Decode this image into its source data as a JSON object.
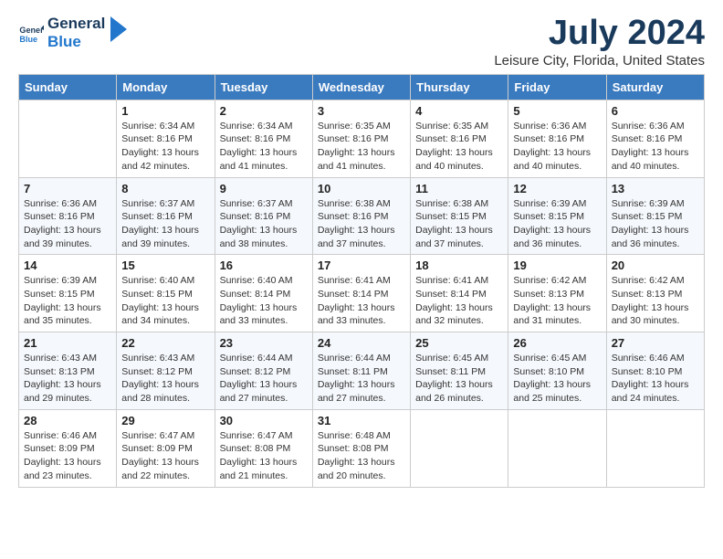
{
  "logo": {
    "general": "General",
    "blue": "Blue"
  },
  "header": {
    "month_year": "July 2024",
    "location": "Leisure City, Florida, United States"
  },
  "days_of_week": [
    "Sunday",
    "Monday",
    "Tuesday",
    "Wednesday",
    "Thursday",
    "Friday",
    "Saturday"
  ],
  "weeks": [
    [
      {
        "day": "",
        "sunrise": "",
        "sunset": "",
        "daylight": ""
      },
      {
        "day": "1",
        "sunrise": "Sunrise: 6:34 AM",
        "sunset": "Sunset: 8:16 PM",
        "daylight": "Daylight: 13 hours and 42 minutes."
      },
      {
        "day": "2",
        "sunrise": "Sunrise: 6:34 AM",
        "sunset": "Sunset: 8:16 PM",
        "daylight": "Daylight: 13 hours and 41 minutes."
      },
      {
        "day": "3",
        "sunrise": "Sunrise: 6:35 AM",
        "sunset": "Sunset: 8:16 PM",
        "daylight": "Daylight: 13 hours and 41 minutes."
      },
      {
        "day": "4",
        "sunrise": "Sunrise: 6:35 AM",
        "sunset": "Sunset: 8:16 PM",
        "daylight": "Daylight: 13 hours and 40 minutes."
      },
      {
        "day": "5",
        "sunrise": "Sunrise: 6:36 AM",
        "sunset": "Sunset: 8:16 PM",
        "daylight": "Daylight: 13 hours and 40 minutes."
      },
      {
        "day": "6",
        "sunrise": "Sunrise: 6:36 AM",
        "sunset": "Sunset: 8:16 PM",
        "daylight": "Daylight: 13 hours and 40 minutes."
      }
    ],
    [
      {
        "day": "7",
        "sunrise": "Sunrise: 6:36 AM",
        "sunset": "Sunset: 8:16 PM",
        "daylight": "Daylight: 13 hours and 39 minutes."
      },
      {
        "day": "8",
        "sunrise": "Sunrise: 6:37 AM",
        "sunset": "Sunset: 8:16 PM",
        "daylight": "Daylight: 13 hours and 39 minutes."
      },
      {
        "day": "9",
        "sunrise": "Sunrise: 6:37 AM",
        "sunset": "Sunset: 8:16 PM",
        "daylight": "Daylight: 13 hours and 38 minutes."
      },
      {
        "day": "10",
        "sunrise": "Sunrise: 6:38 AM",
        "sunset": "Sunset: 8:16 PM",
        "daylight": "Daylight: 13 hours and 37 minutes."
      },
      {
        "day": "11",
        "sunrise": "Sunrise: 6:38 AM",
        "sunset": "Sunset: 8:15 PM",
        "daylight": "Daylight: 13 hours and 37 minutes."
      },
      {
        "day": "12",
        "sunrise": "Sunrise: 6:39 AM",
        "sunset": "Sunset: 8:15 PM",
        "daylight": "Daylight: 13 hours and 36 minutes."
      },
      {
        "day": "13",
        "sunrise": "Sunrise: 6:39 AM",
        "sunset": "Sunset: 8:15 PM",
        "daylight": "Daylight: 13 hours and 36 minutes."
      }
    ],
    [
      {
        "day": "14",
        "sunrise": "Sunrise: 6:39 AM",
        "sunset": "Sunset: 8:15 PM",
        "daylight": "Daylight: 13 hours and 35 minutes."
      },
      {
        "day": "15",
        "sunrise": "Sunrise: 6:40 AM",
        "sunset": "Sunset: 8:15 PM",
        "daylight": "Daylight: 13 hours and 34 minutes."
      },
      {
        "day": "16",
        "sunrise": "Sunrise: 6:40 AM",
        "sunset": "Sunset: 8:14 PM",
        "daylight": "Daylight: 13 hours and 33 minutes."
      },
      {
        "day": "17",
        "sunrise": "Sunrise: 6:41 AM",
        "sunset": "Sunset: 8:14 PM",
        "daylight": "Daylight: 13 hours and 33 minutes."
      },
      {
        "day": "18",
        "sunrise": "Sunrise: 6:41 AM",
        "sunset": "Sunset: 8:14 PM",
        "daylight": "Daylight: 13 hours and 32 minutes."
      },
      {
        "day": "19",
        "sunrise": "Sunrise: 6:42 AM",
        "sunset": "Sunset: 8:13 PM",
        "daylight": "Daylight: 13 hours and 31 minutes."
      },
      {
        "day": "20",
        "sunrise": "Sunrise: 6:42 AM",
        "sunset": "Sunset: 8:13 PM",
        "daylight": "Daylight: 13 hours and 30 minutes."
      }
    ],
    [
      {
        "day": "21",
        "sunrise": "Sunrise: 6:43 AM",
        "sunset": "Sunset: 8:13 PM",
        "daylight": "Daylight: 13 hours and 29 minutes."
      },
      {
        "day": "22",
        "sunrise": "Sunrise: 6:43 AM",
        "sunset": "Sunset: 8:12 PM",
        "daylight": "Daylight: 13 hours and 28 minutes."
      },
      {
        "day": "23",
        "sunrise": "Sunrise: 6:44 AM",
        "sunset": "Sunset: 8:12 PM",
        "daylight": "Daylight: 13 hours and 27 minutes."
      },
      {
        "day": "24",
        "sunrise": "Sunrise: 6:44 AM",
        "sunset": "Sunset: 8:11 PM",
        "daylight": "Daylight: 13 hours and 27 minutes."
      },
      {
        "day": "25",
        "sunrise": "Sunrise: 6:45 AM",
        "sunset": "Sunset: 8:11 PM",
        "daylight": "Daylight: 13 hours and 26 minutes."
      },
      {
        "day": "26",
        "sunrise": "Sunrise: 6:45 AM",
        "sunset": "Sunset: 8:10 PM",
        "daylight": "Daylight: 13 hours and 25 minutes."
      },
      {
        "day": "27",
        "sunrise": "Sunrise: 6:46 AM",
        "sunset": "Sunset: 8:10 PM",
        "daylight": "Daylight: 13 hours and 24 minutes."
      }
    ],
    [
      {
        "day": "28",
        "sunrise": "Sunrise: 6:46 AM",
        "sunset": "Sunset: 8:09 PM",
        "daylight": "Daylight: 13 hours and 23 minutes."
      },
      {
        "day": "29",
        "sunrise": "Sunrise: 6:47 AM",
        "sunset": "Sunset: 8:09 PM",
        "daylight": "Daylight: 13 hours and 22 minutes."
      },
      {
        "day": "30",
        "sunrise": "Sunrise: 6:47 AM",
        "sunset": "Sunset: 8:08 PM",
        "daylight": "Daylight: 13 hours and 21 minutes."
      },
      {
        "day": "31",
        "sunrise": "Sunrise: 6:48 AM",
        "sunset": "Sunset: 8:08 PM",
        "daylight": "Daylight: 13 hours and 20 minutes."
      },
      {
        "day": "",
        "sunrise": "",
        "sunset": "",
        "daylight": ""
      },
      {
        "day": "",
        "sunrise": "",
        "sunset": "",
        "daylight": ""
      },
      {
        "day": "",
        "sunrise": "",
        "sunset": "",
        "daylight": ""
      }
    ]
  ]
}
